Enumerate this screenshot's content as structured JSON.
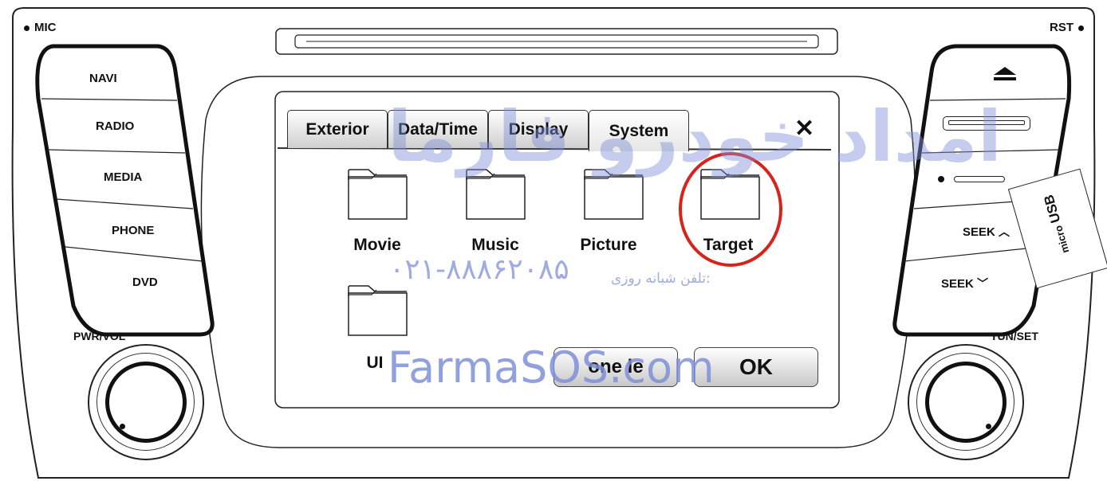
{
  "top_labels": {
    "mic": "MIC",
    "rst": "RST"
  },
  "left_buttons": [
    "NAVI",
    "RADIO",
    "MEDIA",
    "PHONE",
    "DVD"
  ],
  "right_buttons": {
    "seek_up": "SEEK",
    "seek_down": "SEEK",
    "micro_usb_prefix": "micro",
    "micro_usb_main": "USB"
  },
  "knobs": {
    "left_label": "PWR/VOL",
    "right_label": "TUN/SET"
  },
  "screen": {
    "tabs": [
      "Exterior",
      "Data/Time",
      "Display",
      "System"
    ],
    "active_tab": "System",
    "close_glyph": "✕",
    "folders": [
      "Movie",
      "Music",
      "Picture",
      "Target",
      "UI"
    ],
    "highlighted_folder": "Target",
    "buttons": {
      "secondary": "one le",
      "ok": "OK"
    }
  },
  "watermarks": {
    "brand": "FarmaSOS.com",
    "arabic_big": "امداد خودرو فارما",
    "phone": "۰۲۱-۸۸۸۶۲۰۸۵",
    "phone_label": "تلفن شبانه روزی:"
  },
  "colors": {
    "highlight_circle": "#d8231c",
    "watermark": "#7f90d8"
  }
}
